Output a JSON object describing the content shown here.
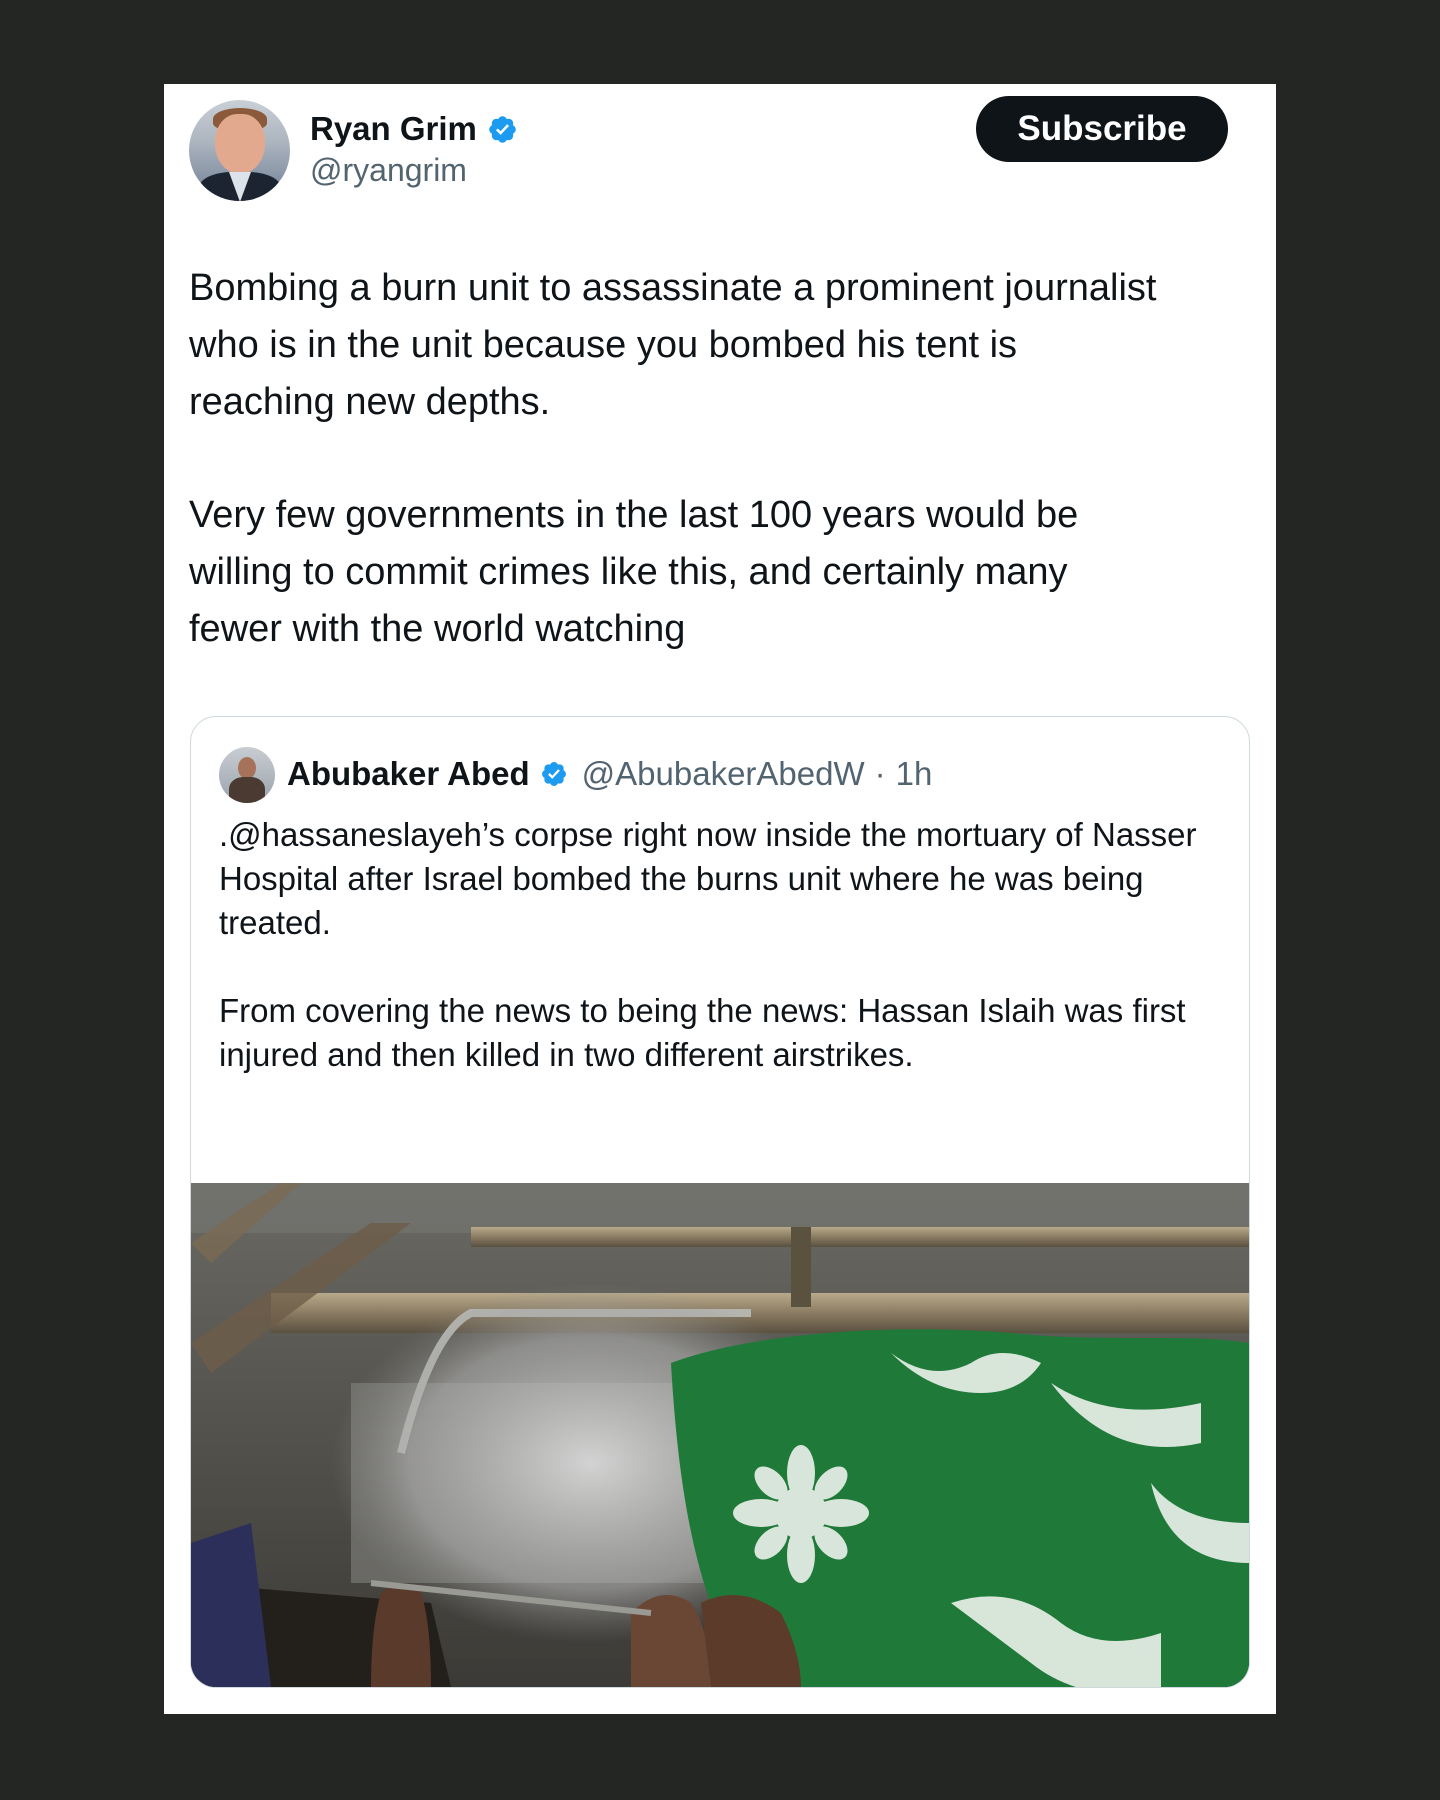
{
  "author": {
    "name": "Ryan Grim",
    "handle": "@ryangrim"
  },
  "subscribe_label": "Subscribe",
  "tweet": {
    "paragraph1": "Bombing a burn unit to assassinate a prominent journalist\nwho is in the unit because you bombed his tent is\nreaching new depths.",
    "paragraph2": "Very few governments in the last 100 years would be\nwilling to commit crimes like this, and certainly many\nfewer with the world watching"
  },
  "quote": {
    "name": "Abubaker Abed",
    "handle": "@AbubakerAbedW",
    "separator": "·",
    "time": "1h",
    "paragraph1": ".@hassaneslayeh’s corpse right now inside the mortuary of Nasser Hospital after Israel bombed the burns unit where he was being treated.",
    "paragraph2": "From covering the news to being the news: Hassan Islaih was first injured and then killed in two different airstrikes."
  },
  "colors": {
    "verified": "#1d9bf0",
    "page_bg": "#242624",
    "blanket_green": "#1f7a3a"
  },
  "icons": {
    "verified": "verified-badge-icon"
  }
}
